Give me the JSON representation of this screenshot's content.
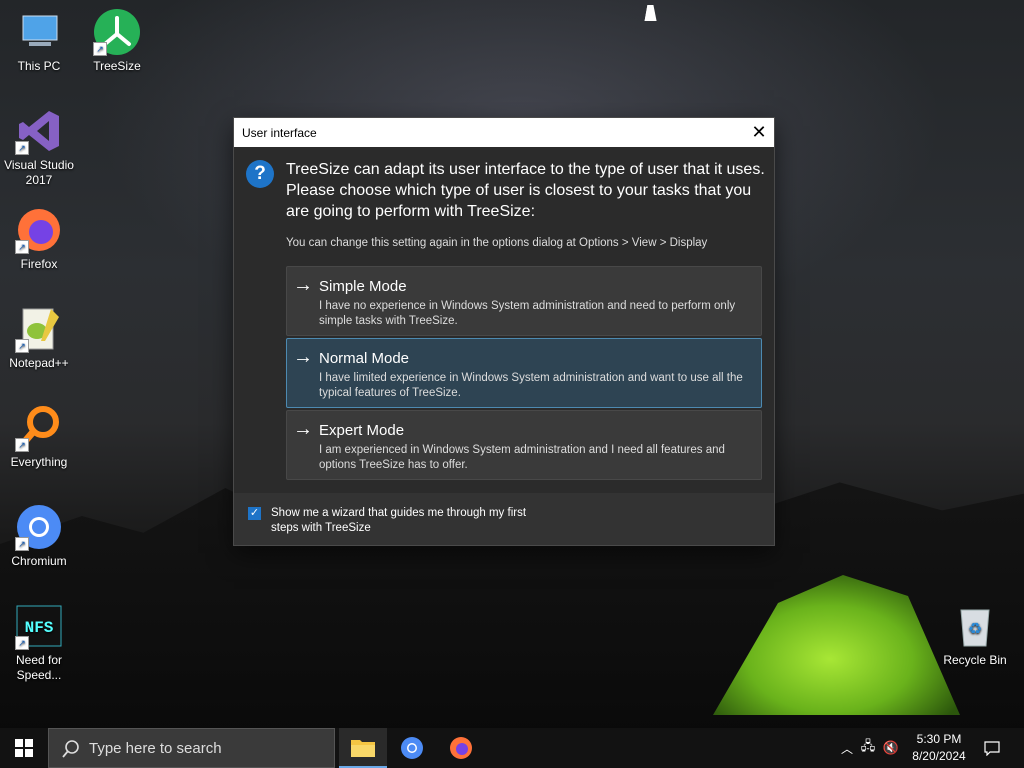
{
  "desktop": {
    "icons": [
      {
        "label": "This PC",
        "icon": "computer-icon"
      },
      {
        "label": "TreeSize",
        "icon": "treesize-icon"
      },
      {
        "label": "Visual Studio 2017",
        "icon": "visual-studio-icon"
      },
      {
        "label": "Firefox",
        "icon": "firefox-icon"
      },
      {
        "label": "Notepad++",
        "icon": "notepad-plus-plus-icon"
      },
      {
        "label": "Everything",
        "icon": "everything-search-icon"
      },
      {
        "label": "Chromium",
        "icon": "chromium-icon"
      },
      {
        "label": "Need for Speed...",
        "icon": "need-for-speed-icon"
      },
      {
        "label": "Recycle Bin",
        "icon": "recycle-bin-icon"
      }
    ]
  },
  "dialog": {
    "title": "User interface",
    "intro": "TreeSize can adapt its user interface to the type of user that it uses. Please choose which type of user is closest to your tasks that you are going to perform with TreeSize:",
    "hint": "You can change this setting again in the options dialog at Options > View > Display",
    "modes": [
      {
        "title": "Simple Mode",
        "description": "I have no experience in Windows System administration and need to perform only simple tasks with TreeSize.",
        "selected": false
      },
      {
        "title": "Normal Mode",
        "description": "I have limited experience in Windows System administration and want to use all the typical features of TreeSize.",
        "selected": true
      },
      {
        "title": "Expert Mode",
        "description": "I am experienced in Windows System administration and I need all features and options TreeSize has to offer.",
        "selected": false
      }
    ],
    "wizard_checkbox": {
      "label": "Show me a wizard that guides me through my first steps with TreeSize",
      "checked": true
    }
  },
  "taskbar": {
    "search_placeholder": "Type here to search",
    "apps": [
      "file-explorer-icon",
      "chromium-icon",
      "firefox-icon"
    ],
    "time": "5:30 PM",
    "date": "8/20/2024"
  },
  "colors": {
    "accent": "#1e74c8",
    "selected_mode_bg": "#2e4453",
    "selected_mode_border": "#4d8ab1",
    "dialog_bg": "#2b2b2b"
  }
}
